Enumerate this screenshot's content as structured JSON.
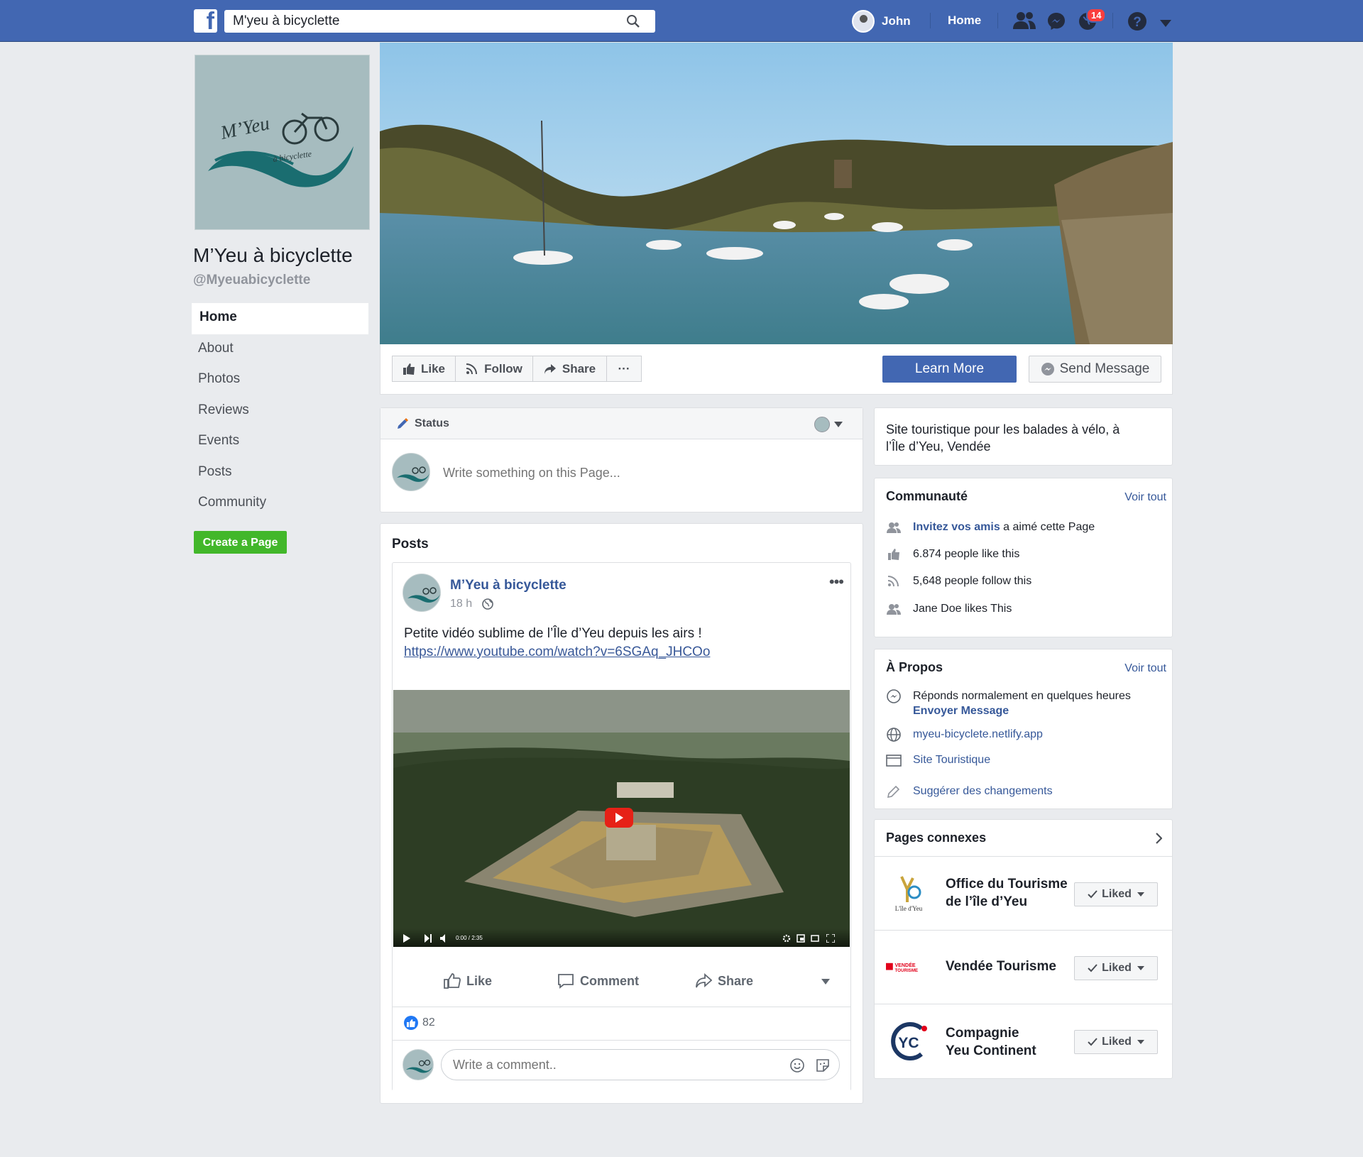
{
  "topbar": {
    "search_value": "M'yeu à bicyclette",
    "user_name": "John",
    "home_label": "Home",
    "notification_count": "14"
  },
  "page": {
    "name": "M’Yeu à bicyclette",
    "handle": "@Myeuabicyclette",
    "logo_text": "M’Yeu",
    "logo_subtext": "à bicyclette"
  },
  "left_nav": {
    "items": [
      "Home",
      "About",
      "Photos",
      "Reviews",
      "Events",
      "Posts",
      "Community"
    ],
    "active": "Home"
  },
  "create_page_label": "Create a Page",
  "actions": {
    "like": "Like",
    "follow": "Follow",
    "share": "Share",
    "more": "···",
    "learn_more": "Learn More",
    "send_message": "Send Message"
  },
  "status": {
    "label": "Status",
    "placeholder": "Write something on this Page..."
  },
  "posts": {
    "title": "Posts",
    "post": {
      "author": "M’Yeu à bicyclette",
      "time": "18 h",
      "text": "Petite vidéo sublime de l’Île d’Yeu depuis les airs !",
      "link": "https://www.youtube.com/watch?v=6SGAq_JHCOo",
      "video_time": "0:00 / 2:35",
      "like": "Like",
      "comment": "Comment",
      "share": "Share",
      "reaction_count": "82",
      "comment_placeholder": "Write a comment.."
    }
  },
  "about": {
    "description": "Site touristique pour les balades à vélo, à l’Île d’Yeu, Vendée"
  },
  "community": {
    "title": "Communauté",
    "see_all": "Voir tout",
    "invite_link": "Invitez vos amis",
    "invite_text": " a aimé cette Page",
    "likes": "6.874 people like this",
    "follows": "5,648 people follow this",
    "friend_like": "Jane Doe likes This"
  },
  "apropos": {
    "title": "À Propos",
    "see_all": "Voir tout",
    "response": "Réponds normalement en quelques heures",
    "send_message": "Envoyer Message",
    "website": "myeu-bicyclete.netlify.app",
    "category": "Site Touristique",
    "suggest": "Suggérer des changements"
  },
  "related": {
    "title": "Pages connexes",
    "liked_label": "Liked",
    "pages": [
      {
        "name_line1": "Office du Tourisme",
        "name_line2": "de l’île d’Yeu",
        "logo_text": "L'île d'Yeu"
      },
      {
        "name_line1": "Vendée Tourisme",
        "name_line2": "",
        "logo_text": "VENDÉE TOURISME"
      },
      {
        "name_line1": "Compagnie",
        "name_line2": "Yeu Continent",
        "logo_text": "YC"
      }
    ]
  },
  "colors": {
    "brand": "#4267b2",
    "link": "#365899",
    "create_green": "#42b72a",
    "badge_red": "#fa3e3e"
  }
}
